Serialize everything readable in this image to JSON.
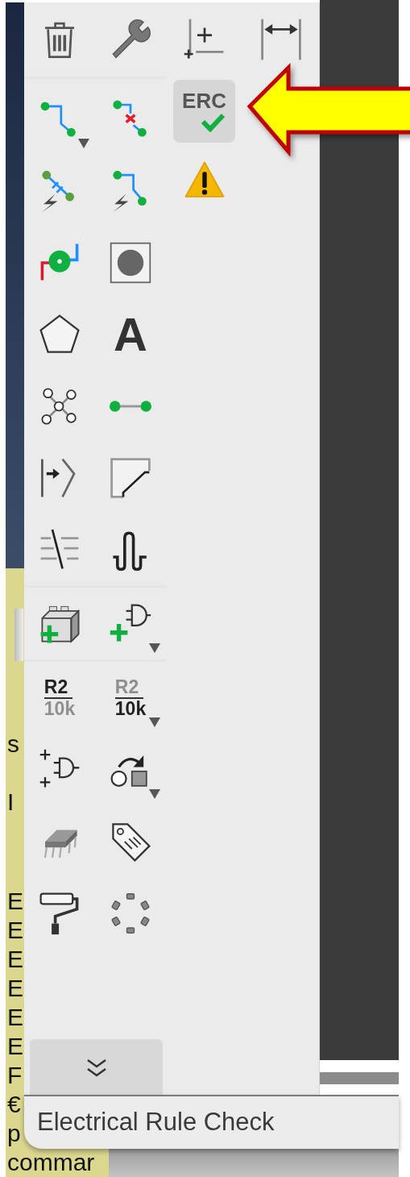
{
  "document": {
    "upper_lines": [
      "s",
      "I"
    ],
    "lower_lines": [
      "E",
      "E",
      "E",
      "E",
      "E",
      "E",
      "F",
      "€",
      "p",
      "commar"
    ]
  },
  "palette": {
    "left_groups": [
      {
        "rows": [
          [
            {
              "kind": "trash",
              "selected": false,
              "dropdown": false
            },
            {
              "kind": "wrench",
              "selected": false,
              "dropdown": false
            }
          ]
        ]
      },
      {
        "rows": [
          [
            {
              "kind": "route-wire",
              "selected": false,
              "dropdown": true
            },
            {
              "kind": "delete-wire",
              "selected": false,
              "dropdown": false
            }
          ],
          [
            {
              "kind": "capacitor-bolt",
              "selected": false,
              "dropdown": false
            },
            {
              "kind": "wire-bolt",
              "selected": false,
              "dropdown": false
            }
          ],
          [
            {
              "kind": "via",
              "selected": false,
              "dropdown": false
            },
            {
              "kind": "pad",
              "selected": false,
              "dropdown": false
            }
          ],
          [
            {
              "kind": "pentagon",
              "selected": false,
              "dropdown": false
            },
            {
              "kind": "text",
              "text": "A",
              "selected": false,
              "dropdown": false
            }
          ],
          [
            {
              "kind": "network",
              "selected": false,
              "dropdown": false
            },
            {
              "kind": "connection",
              "selected": false,
              "dropdown": false
            }
          ],
          [
            {
              "kind": "arrow-bracket",
              "selected": false,
              "dropdown": false
            },
            {
              "kind": "corner",
              "selected": false,
              "dropdown": false
            }
          ],
          [
            {
              "kind": "strike-lines",
              "selected": false,
              "dropdown": false
            },
            {
              "kind": "meander",
              "selected": false,
              "dropdown": false
            }
          ]
        ]
      },
      {
        "rows": [
          [
            {
              "kind": "block-add",
              "selected": false,
              "dropdown": false
            },
            {
              "kind": "gate-add",
              "selected": false,
              "dropdown": true
            }
          ]
        ]
      },
      {
        "rows": [
          [
            {
              "kind": "ref-label",
              "ref": "R2",
              "value": "10k",
              "selected": false,
              "dropdown": false
            },
            {
              "kind": "value-label",
              "ref": "R2",
              "value": "10k",
              "selected": false,
              "dropdown": true
            }
          ],
          [
            {
              "kind": "gate-plus",
              "selected": false,
              "dropdown": false
            },
            {
              "kind": "rotate",
              "selected": false,
              "dropdown": true
            }
          ],
          [
            {
              "kind": "chip",
              "selected": false,
              "dropdown": false
            },
            {
              "kind": "tag",
              "selected": false,
              "dropdown": false
            }
          ],
          [
            {
              "kind": "roller",
              "selected": false,
              "dropdown": false
            },
            {
              "kind": "pad-ring",
              "selected": false,
              "dropdown": false
            }
          ]
        ]
      }
    ],
    "right_rows": [
      [
        {
          "kind": "grid-origin",
          "selected": false,
          "dropdown": false
        },
        {
          "kind": "measure",
          "selected": false,
          "dropdown": false
        }
      ],
      [
        {
          "kind": "erc",
          "text": "ERC",
          "selected": true,
          "dropdown": false
        }
      ],
      [
        {
          "kind": "warning",
          "selected": false,
          "dropdown": false
        }
      ]
    ]
  },
  "tooltip": {
    "text": "Electrical Rule Check"
  }
}
